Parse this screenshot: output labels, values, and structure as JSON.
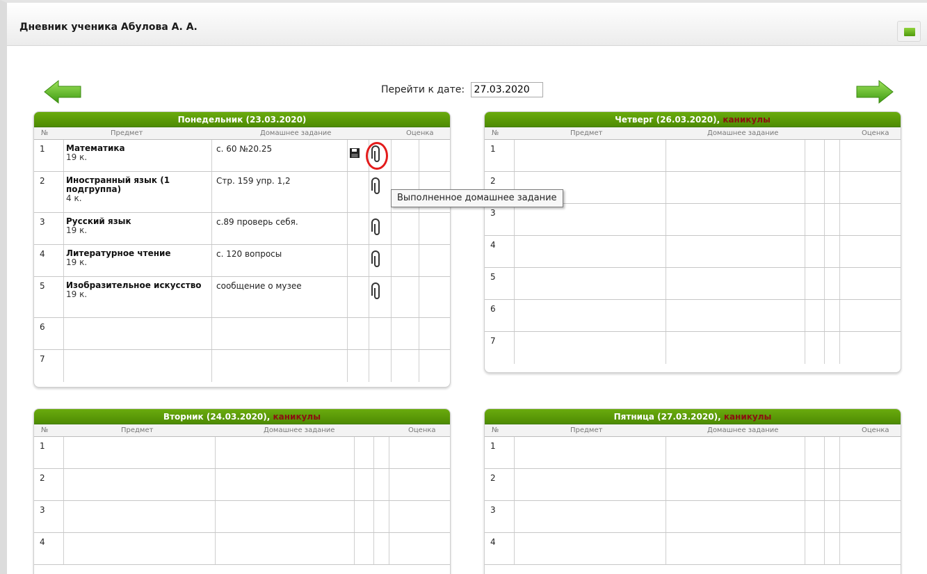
{
  "page": {
    "title": "Дневник ученика Абулова А. А."
  },
  "date_nav": {
    "label": "Перейти к дате:",
    "value": "27.03.2020"
  },
  "columns": {
    "num": "№",
    "subject": "Предмет",
    "homework": "Домашнее задание",
    "grade": "Оценка"
  },
  "vacation_label": "каникулы",
  "days": {
    "mon": {
      "title": "Понедельник (23.03.2020)",
      "rows": [
        {
          "num": "1",
          "subject": "Математика",
          "hours": "19 к.",
          "homework": "с. 60 №20.25"
        },
        {
          "num": "2",
          "subject": "Иностранный язык (1 подгруппа)",
          "hours": "4 к.",
          "homework": "Стр. 159 упр. 1,2"
        },
        {
          "num": "3",
          "subject": "Русский язык",
          "hours": "19 к.",
          "homework": "с.89 проверь себя."
        },
        {
          "num": "4",
          "subject": "Литературное чтение",
          "hours": "19 к.",
          "homework": "с. 120 вопросы"
        },
        {
          "num": "5",
          "subject": "Изобразительное искусство",
          "hours": "19 к.",
          "homework": "сообщение о музее"
        },
        {
          "num": "6",
          "subject": "",
          "hours": "",
          "homework": ""
        },
        {
          "num": "7",
          "subject": "",
          "hours": "",
          "homework": ""
        }
      ]
    },
    "thu": {
      "title": "Четверг (26.03.2020), ",
      "vacation": "каникулы",
      "rows": [
        {
          "num": "1"
        },
        {
          "num": "2"
        },
        {
          "num": "3"
        },
        {
          "num": "4"
        },
        {
          "num": "5"
        },
        {
          "num": "6"
        },
        {
          "num": "7"
        }
      ]
    },
    "tue": {
      "title": "Вторник (24.03.2020), ",
      "vacation": "каникулы",
      "rows": [
        {
          "num": "1"
        },
        {
          "num": "2"
        },
        {
          "num": "3"
        },
        {
          "num": "4"
        }
      ]
    },
    "fri": {
      "title": "Пятница (27.03.2020), ",
      "vacation": "каникулы",
      "rows": [
        {
          "num": "1"
        },
        {
          "num": "2"
        },
        {
          "num": "3"
        },
        {
          "num": "4"
        }
      ]
    }
  },
  "tooltip": "Выполненное домашнее задание",
  "icons": {
    "prev": "arrow-left-icon",
    "next": "arrow-right-icon",
    "attach": "paperclip-icon",
    "save": "floppy-disk-icon",
    "window": "green-square-icon"
  },
  "colors": {
    "header_green": "#5a9a08",
    "vacation_red": "#8b1010",
    "highlight_ring": "#e31b1b"
  }
}
